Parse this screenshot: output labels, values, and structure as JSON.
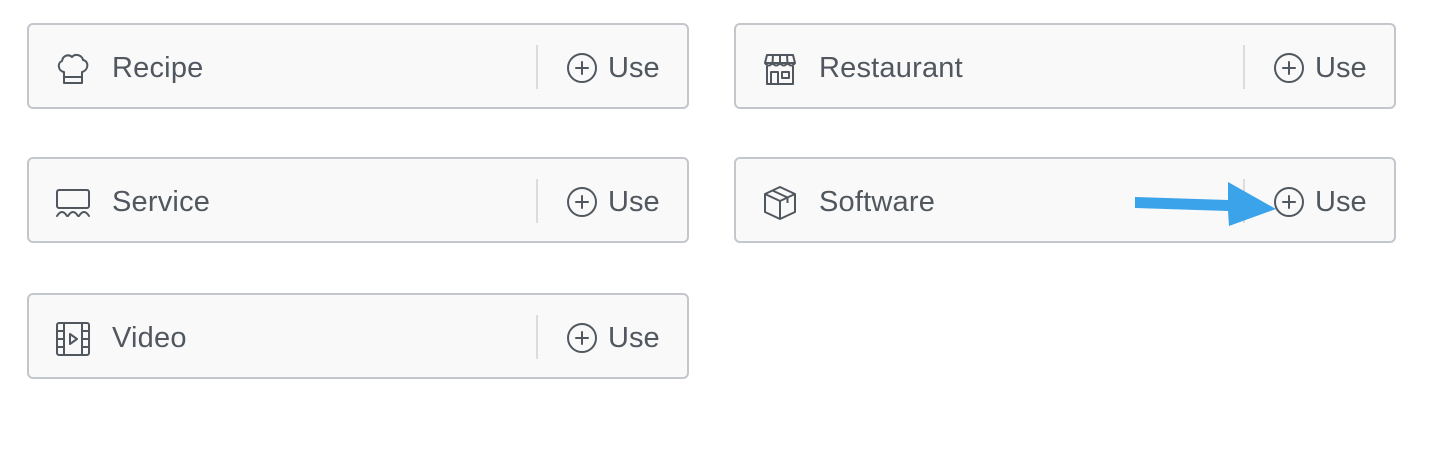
{
  "colors": {
    "card_background": "#f9f9fa",
    "card_border": "#c3c6cb",
    "text": "#50575e",
    "annotation_arrow": "#3aa3ea"
  },
  "schema_types": [
    {
      "label": "Recipe",
      "icon": "chef-hat-icon",
      "action_label": "Use"
    },
    {
      "label": "Restaurant",
      "icon": "storefront-icon",
      "action_label": "Use"
    },
    {
      "label": "Service",
      "icon": "service-desk-icon",
      "action_label": "Use"
    },
    {
      "label": "Software",
      "icon": "package-box-icon",
      "action_label": "Use"
    },
    {
      "label": "Video",
      "icon": "film-strip-icon",
      "action_label": "Use"
    }
  ],
  "annotation": {
    "icon": "arrow-right-icon"
  }
}
